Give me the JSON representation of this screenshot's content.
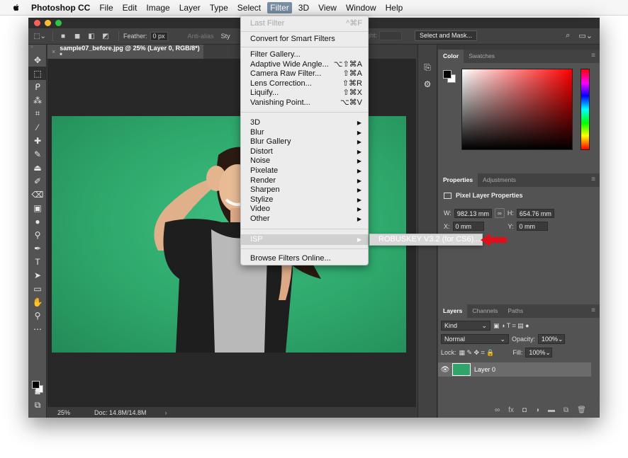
{
  "menubar": {
    "app_name": "Photoshop CC",
    "items": [
      "File",
      "Edit",
      "Image",
      "Layer",
      "Type",
      "Select",
      "Filter",
      "3D",
      "View",
      "Window",
      "Help"
    ]
  },
  "options_bar": {
    "feather_label": "Feather:",
    "feather_value": "0 px",
    "anti_alias": "Anti-alias",
    "style_partial": "Sty",
    "height_partial": "ight:",
    "select_and_mask": "Select and Mask..."
  },
  "document": {
    "tab_title": "sample07_before.jpg @ 25% (Layer 0, RGB/8*) *",
    "zoom": "25%",
    "doc_size": "Doc: 14.8M/14.8M"
  },
  "color_panel": {
    "tabs": [
      "Color",
      "Swatches"
    ]
  },
  "properties_panel": {
    "tabs": [
      "Properties",
      "Adjustments"
    ],
    "title": "Pixel Layer Properties",
    "w_label": "W:",
    "w_value": "982.13 mm",
    "h_label": "H:",
    "h_value": "654.76 mm",
    "x_label": "X:",
    "x_value": "0 mm",
    "y_label": "Y:",
    "y_value": "0 mm"
  },
  "layers_panel": {
    "tabs": [
      "Layers",
      "Channels",
      "Paths"
    ],
    "filter_kind": "Kind",
    "blend_mode": "Normal",
    "opacity_label": "Opacity:",
    "opacity_value": "100%",
    "lock_label": "Lock:",
    "fill_label": "Fill:",
    "fill_value": "100%",
    "layer_name": "Layer 0"
  },
  "filter_menu": {
    "last_filter": "Last Filter",
    "last_filter_shortcut": "^⌘F",
    "convert_smart": "Convert for Smart Filters",
    "group2": [
      {
        "label": "Filter Gallery...",
        "shortcut": ""
      },
      {
        "label": "Adaptive Wide Angle...",
        "shortcut": "⌥⇧⌘A"
      },
      {
        "label": "Camera Raw Filter...",
        "shortcut": "⇧⌘A"
      },
      {
        "label": "Lens Correction...",
        "shortcut": "⇧⌘R"
      },
      {
        "label": "Liquify...",
        "shortcut": "⇧⌘X"
      },
      {
        "label": "Vanishing Point...",
        "shortcut": "⌥⌘V"
      }
    ],
    "group3": [
      "3D",
      "Blur",
      "Blur Gallery",
      "Distort",
      "Noise",
      "Pixelate",
      "Render",
      "Sharpen",
      "Stylize",
      "Video",
      "Other"
    ],
    "isp": "ISP",
    "browse_online": "Browse Filters Online...",
    "submenu_item": "ROBUSKEY V3.2 (for CS6)..."
  },
  "colors": {
    "accent_green": "#2ea76b",
    "arrow_red": "#e0101a"
  }
}
